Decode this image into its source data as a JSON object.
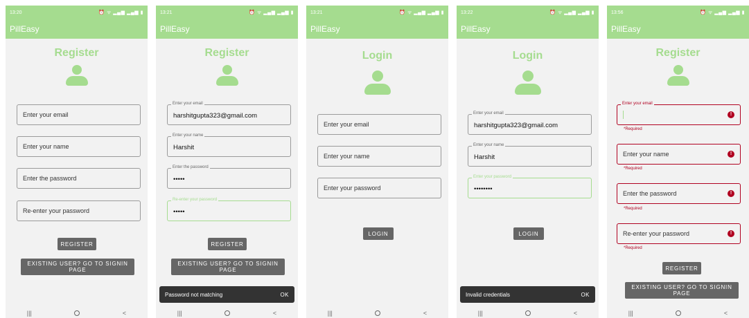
{
  "app_title": "PillEasy",
  "colors": {
    "accent": "#a5dc8f",
    "error": "#b00020",
    "button": "#666666",
    "snackbar": "#333333"
  },
  "screens": [
    {
      "time": "13:20",
      "title": "Register",
      "fields": [
        {
          "placeholder": "Enter your email"
        },
        {
          "placeholder": "Enter your name"
        },
        {
          "placeholder": "Enter the password"
        },
        {
          "placeholder": "Re-enter your password"
        }
      ],
      "register_label": "REGISTER",
      "signin_label": "EXISTING USER? GO TO SIGNIN PAGE"
    },
    {
      "time": "13:21",
      "title": "Register",
      "fields": [
        {
          "label": "Enter your email",
          "value": "harshitgupta323@gmail.com"
        },
        {
          "label": "Enter your name",
          "value": "Harshit"
        },
        {
          "label": "Enter the password",
          "value": "•••••"
        },
        {
          "label": "Re-enter your password",
          "value": "•••••"
        }
      ],
      "register_label": "REGISTER",
      "signin_label": "EXISTING USER? GO TO SIGNIN PAGE",
      "snackbar": {
        "message": "Password not matching",
        "action": "OK"
      }
    },
    {
      "time": "13:21",
      "title": "Login",
      "fields": [
        {
          "placeholder": "Enter your email"
        },
        {
          "placeholder": "Enter your name"
        },
        {
          "placeholder": "Enter your password"
        }
      ],
      "login_label": "LOGIN"
    },
    {
      "time": "13:22",
      "title": "Login",
      "fields": [
        {
          "label": "Enter your email",
          "value": "harshitgupta323@gmail.com"
        },
        {
          "label": "Enter your name",
          "value": "Harshit"
        },
        {
          "label": "Enter your password",
          "value": "••••••••"
        }
      ],
      "login_label": "LOGIN",
      "snackbar": {
        "message": "Invalid credentials",
        "action": "OK"
      }
    },
    {
      "time": "13:56",
      "title": "Register",
      "fields": [
        {
          "label": "Enter your email"
        },
        {
          "placeholder": "Enter your name"
        },
        {
          "placeholder": "Enter the password"
        },
        {
          "placeholder": "Re-enter your password"
        }
      ],
      "error_text": "*Required",
      "register_label": "REGISTER",
      "signin_label": "EXISTING USER? GO TO SIGNIN PAGE"
    }
  ]
}
